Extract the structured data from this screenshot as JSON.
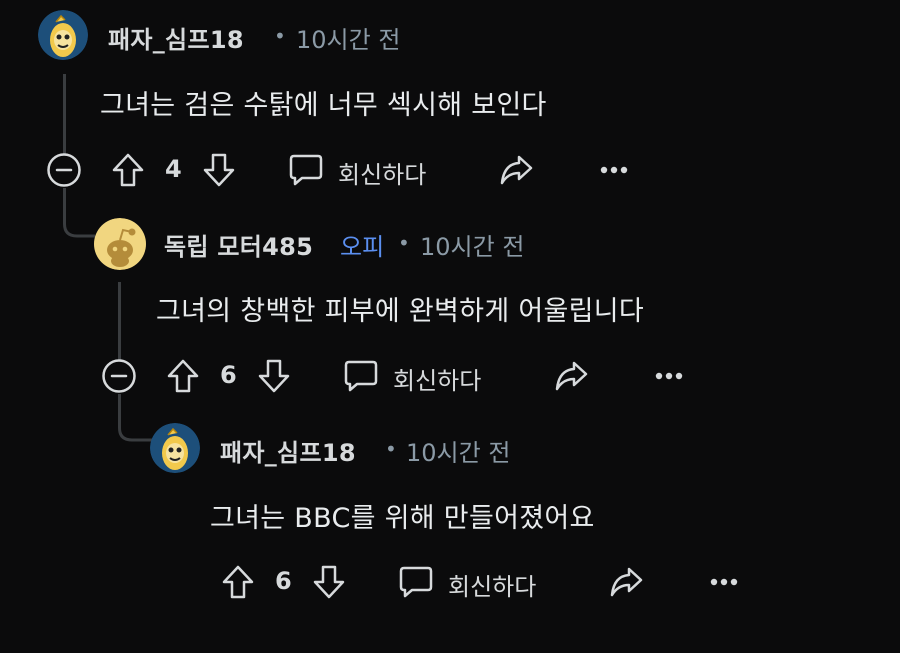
{
  "comments": [
    {
      "username": "패자_심프18",
      "time": "10시간 전",
      "body": "그녀는 검은 수탉에 너무 섹시해 보인다",
      "votes": "4",
      "reply_label": "회신하다"
    },
    {
      "username": "독립 모터485",
      "op_badge": "오피",
      "time": "10시간 전",
      "body": "그녀의 창백한 피부에 완벽하게 어울립니다",
      "votes": "6",
      "reply_label": "회신하다"
    },
    {
      "username": "패자_심프18",
      "time": "10시간 전",
      "body": "그녀는 BBC를 위해 만들어졌어요",
      "votes": "6",
      "reply_label": "회신하다"
    }
  ],
  "separator": "•",
  "colors": {
    "background": "#0b0b0c",
    "op_badge": "#5b8ff0",
    "muted": "#8b9aa6",
    "thread_line": "#3a3d40"
  }
}
